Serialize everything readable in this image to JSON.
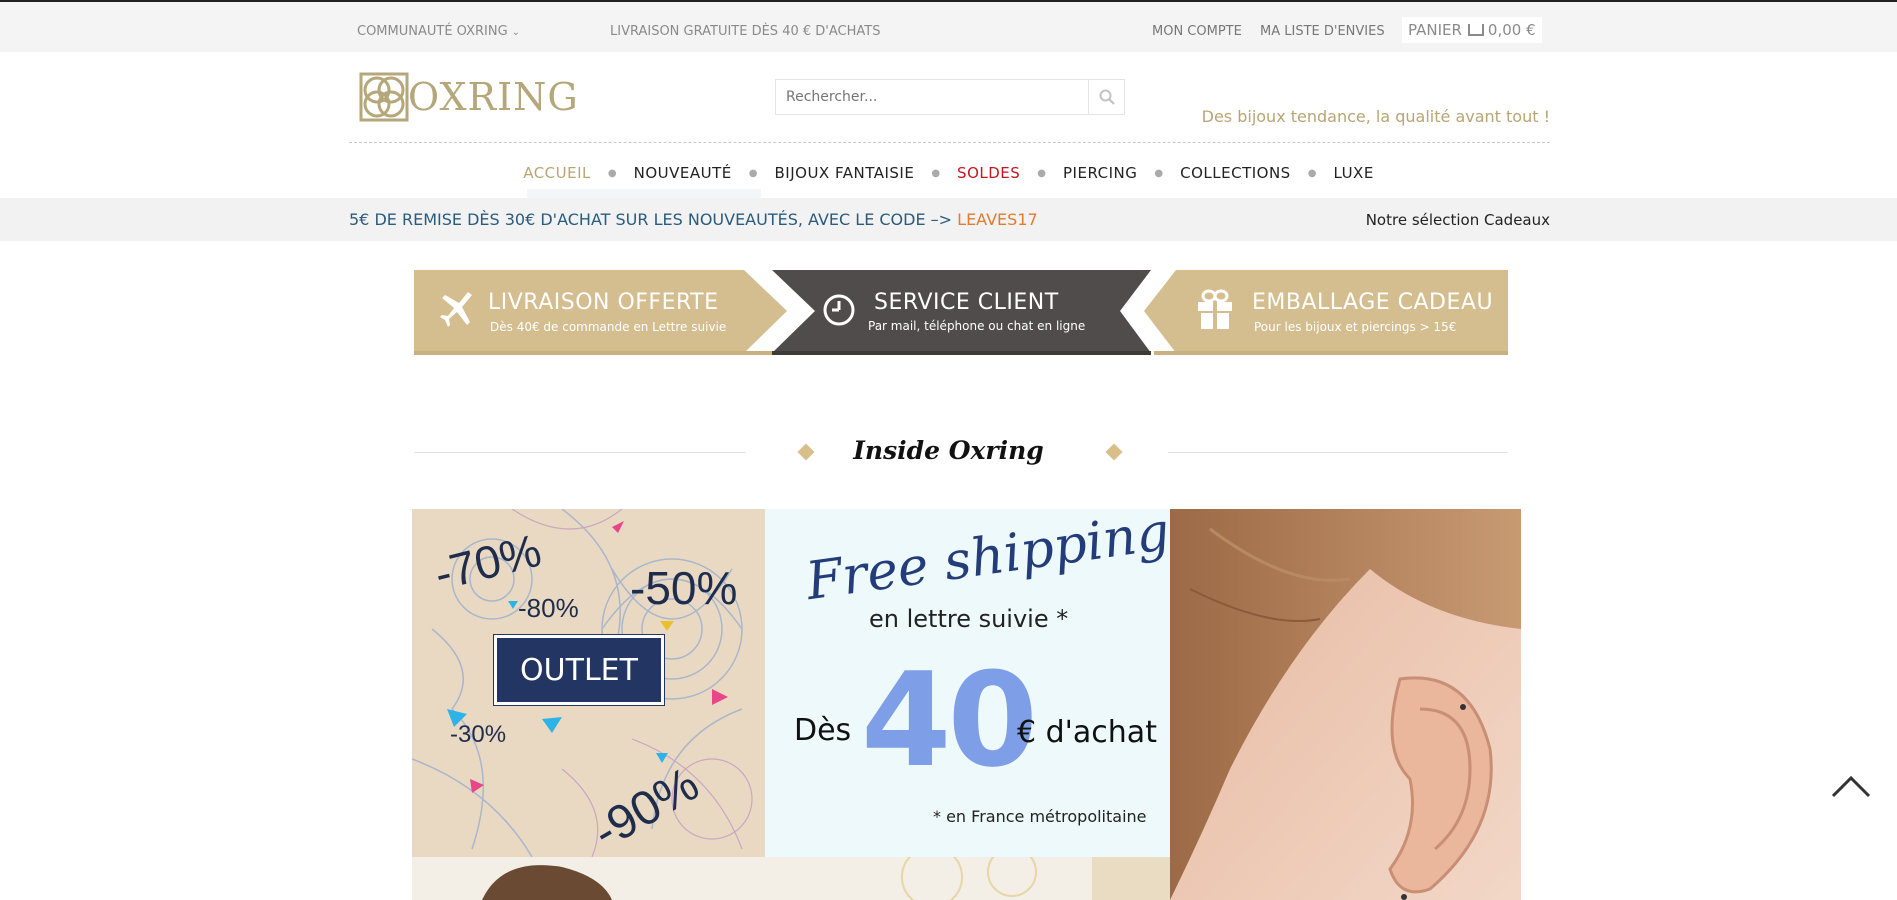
{
  "topbar": {
    "community": "COMMUNAUTÉ OXRING",
    "shipping": "LIVRAISON GRATUITE DÈS 40 € D'ACHATS",
    "account": "MON COMPTE",
    "wishlist": "MA LISTE D'ENVIES",
    "cart_label": "PANIER",
    "cart_total": "0,00 €"
  },
  "brand": {
    "name": "OXRING",
    "tagline": "Des bijoux tendance, la qualité avant tout !"
  },
  "search": {
    "placeholder": "Rechercher..."
  },
  "nav": {
    "items": [
      "ACCUEIL",
      "NOUVEAUTÉ",
      "BIJOUX FANTAISIE",
      "SOLDES",
      "PIERCING",
      "COLLECTIONS",
      "LUXE"
    ]
  },
  "promo": {
    "text": "5€ DE REMISE DÈS 30€ D'ACHAT SUR LES NOUVEAUTÉS, AVEC LE CODE –> ",
    "code": "LEAVES17",
    "gifts_link": "Notre sélection Cadeaux"
  },
  "banners": [
    {
      "title": "LIVRAISON OFFERTE",
      "subtitle": "Dès 40€ de commande en Lettre suivie"
    },
    {
      "title": "SERVICE CLIENT",
      "subtitle": "Par mail, téléphone ou chat en ligne"
    },
    {
      "title": "EMBALLAGE CADEAU",
      "subtitle": "Pour les bijoux et piercings > 15€"
    }
  ],
  "section": {
    "title": "Inside Oxring"
  },
  "tiles": {
    "outlet": {
      "button": "OUTLET",
      "discounts": [
        "-70%",
        "-50%",
        "-80%",
        "-30%",
        "-90%"
      ]
    },
    "shipping": {
      "script": "Free shipping",
      "subline": "en lettre suivie *",
      "des": "Dès",
      "amount": "40",
      "suffix": "€ d'achat",
      "note": "* en France métropolitaine"
    }
  },
  "colors": {
    "gold": "#b9a574",
    "banner_gold": "#d4bd8f",
    "banner_dark": "#504c4c",
    "sale_red": "#c4161c",
    "promo_blue": "#2a5b7e",
    "promo_code": "#e27b2e"
  }
}
